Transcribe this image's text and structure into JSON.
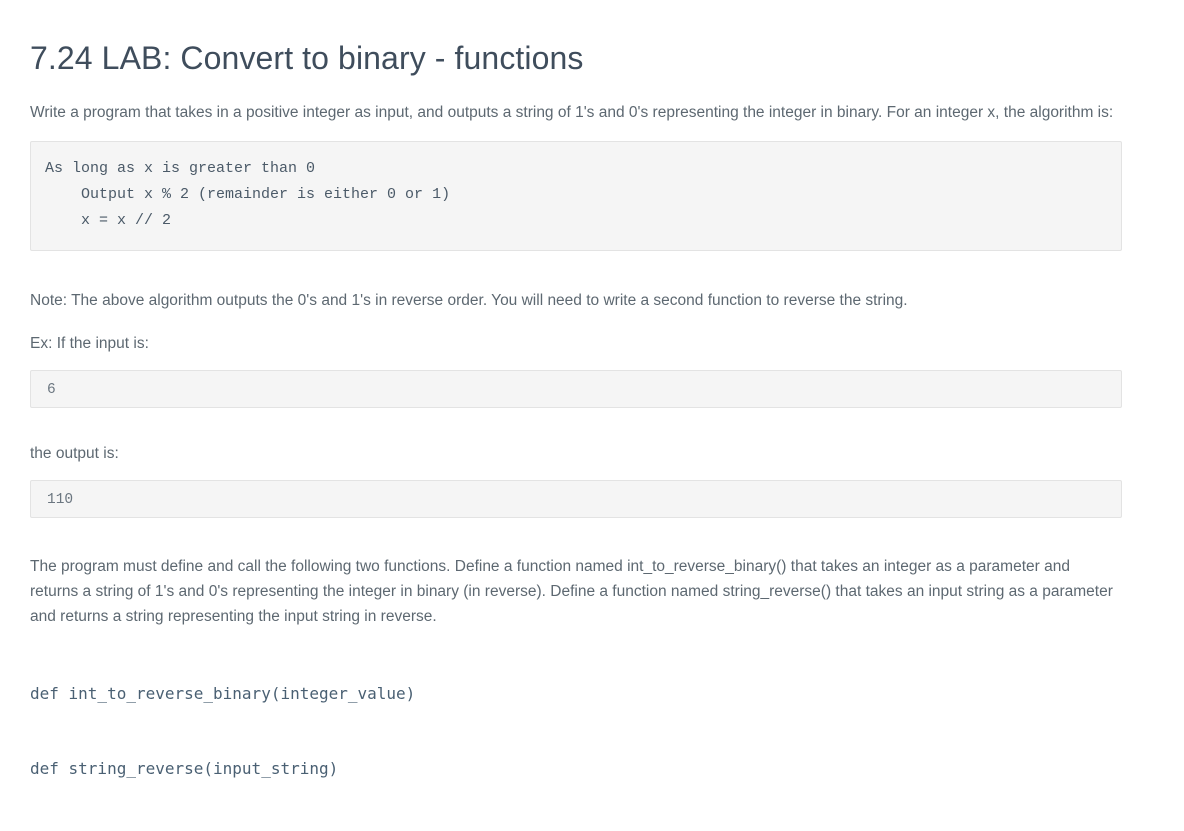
{
  "page": {
    "title": "7.24 LAB: Convert to binary - functions",
    "intro_paragraph": "Write a program that takes in a positive integer as input, and outputs a string of 1's and 0's representing the integer in binary. For an integer x, the algorithm is:",
    "algorithm_code": "As long as x is greater than 0\n    Output x % 2 (remainder is either 0 or 1)\n    x = x // 2",
    "note_paragraph": "Note: The above algorithm outputs the 0's and 1's in reverse order. You will need to write a second function to reverse the string.",
    "example_input_label": "Ex: If the input is:",
    "example_input_value": "6",
    "example_output_label": "the output is:",
    "example_output_value": "110",
    "requirements_paragraph": "The program must define and call the following two functions. Define a function named int_to_reverse_binary() that takes an integer as a parameter and returns a string of 1's and 0's representing the integer in binary (in reverse). Define a function named string_reverse() that takes an input string as a parameter and returns a string representing the input string in reverse.",
    "function_signatures": {
      "first": "def int_to_reverse_binary(integer_value)",
      "second": "def string_reverse(input_string)"
    }
  },
  "colors": {
    "title_text": "#3f4d5c",
    "body_text": "#5d6871",
    "code_background": "#f5f5f5",
    "code_border": "#e3e3e3",
    "code_text": "#4b5a68",
    "signature_text": "#4a6073",
    "page_background": "#ffffff"
  }
}
